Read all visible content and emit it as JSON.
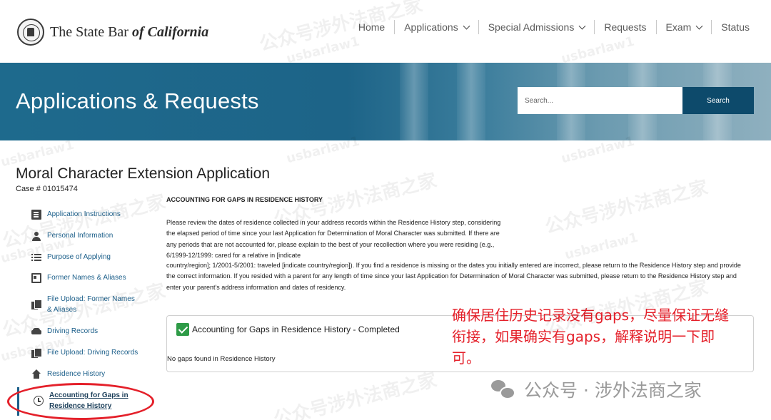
{
  "header": {
    "logo": {
      "text_plain": "The State Bar ",
      "text_italic": "of California"
    },
    "nav": [
      {
        "label": "Home",
        "dropdown": false
      },
      {
        "label": "Applications",
        "dropdown": true
      },
      {
        "label": "Special Admissions",
        "dropdown": true
      },
      {
        "label": "Requests",
        "dropdown": false
      },
      {
        "label": "Exam",
        "dropdown": true
      },
      {
        "label": "Status",
        "dropdown": false
      }
    ]
  },
  "hero": {
    "title": "Applications & Requests",
    "search_placeholder": "Search...",
    "search_button": "Search"
  },
  "page": {
    "title": "Moral Character Extension Application",
    "case_number": "Case # 01015474"
  },
  "sidebar": {
    "items": [
      {
        "label": "Application Instructions",
        "icon": "document-list-icon"
      },
      {
        "label": "Personal Information",
        "icon": "person-icon"
      },
      {
        "label": "Purpose of Applying",
        "icon": "list-icon"
      },
      {
        "label": "Former Names & Aliases",
        "icon": "id-card-icon"
      },
      {
        "label": "File Upload: Former Names & Aliases",
        "icon": "files-icon"
      },
      {
        "label": "Driving Records",
        "icon": "car-icon"
      },
      {
        "label": "File Upload: Driving Records",
        "icon": "files-icon"
      },
      {
        "label": "Residence History",
        "icon": "home-icon"
      },
      {
        "label": "Accounting for Gaps in Residence History",
        "icon": "clock-icon",
        "active": true
      }
    ]
  },
  "main": {
    "heading": "ACCOUNTING FOR GAPS IN RESIDENCE HISTORY",
    "para1": "Please review the dates of residence collected in your address records within the Residence History step, considering the elapsed period of time since your last Application for Determination of Moral Character was submitted. If there are any periods that are not accounted for, please explain to the best of your recollection where you were residing (e.g., 6/1999-12/1999: cared for a relative in [indicate",
    "para2": "country/region]; 1/2001-5/2001: traveled [indicate country/region]). If you find a residence is missing or the dates you initially entered are incorrect, please return to the Residence History step and provide the correct information. If you resided with a parent for any length of time since your last Application for Determination of Moral Character was submitted, please return to the Residence History step and enter your parent's address information and dates of residency.",
    "result": {
      "title": "Accounting for Gaps in Residence History - Completed",
      "note": "No gaps found in Residence History"
    }
  },
  "annotation": {
    "text": "确保居住历史记录没有gaps，尽量保证无缝衔接，如果确实有gaps，解释说明一下即可。",
    "color": "#e4202a"
  },
  "watermarks": {
    "cn": "公众号涉外法商之家",
    "en": "usbarlaw1",
    "footer": "公众号 · 涉外法商之家"
  },
  "colors": {
    "link": "#1c5f8a",
    "hero": "#1e6a8d",
    "search_button": "#0d4a6b",
    "success": "#2e9b47"
  }
}
